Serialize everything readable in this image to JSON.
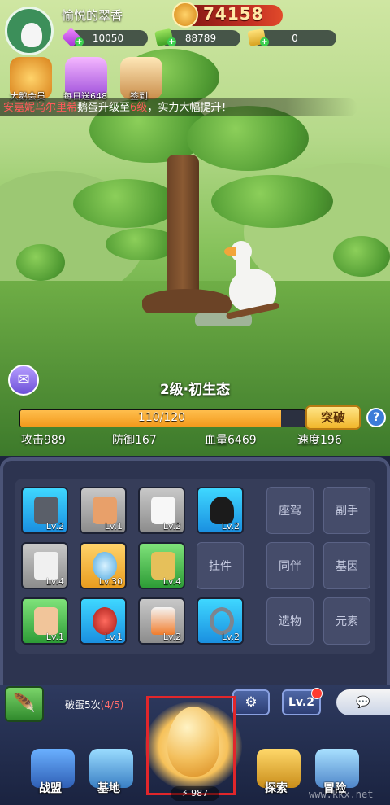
{
  "player": {
    "name": "愉悦的翠香",
    "power": "74158"
  },
  "currencies": [
    {
      "name": "gems",
      "value": "10050"
    },
    {
      "name": "cash",
      "value": "88789"
    },
    {
      "name": "tickets",
      "value": "0"
    }
  ],
  "top_menu": [
    {
      "label": "大鹅会员",
      "icon": "crown-icon"
    },
    {
      "label": "每日送648",
      "icon": "gift-icon"
    },
    {
      "label": "签到",
      "icon": "calendar-icon"
    }
  ],
  "news": {
    "name": "安嘉妮乌尔里希",
    "text_a": "鹅蛋升级至",
    "level": "6级",
    "text_b": "，实力大幅提升！"
  },
  "stage": {
    "title": "2级·初生态",
    "xp_text": "110/120",
    "xp_current": 110,
    "xp_max": 120,
    "break_label": "突破",
    "help_label": "?"
  },
  "stats": [
    {
      "label": "攻击989"
    },
    {
      "label": "防御167"
    },
    {
      "label": "血量6469"
    },
    {
      "label": "速度196"
    }
  ],
  "equipment": [
    {
      "name": "chainsaw",
      "level": "Lv.2",
      "rarity": "blue"
    },
    {
      "name": "muscle-arm",
      "level": "Lv.1",
      "rarity": "gray"
    },
    {
      "name": "tank-top",
      "level": "Lv.2",
      "rarity": "gray"
    },
    {
      "name": "balaclava",
      "level": "Lv.2",
      "rarity": "blue"
    },
    {
      "name": "paper-hat",
      "level": "Lv.4",
      "rarity": "gray"
    },
    {
      "name": "medal",
      "level": "Lv.30",
      "rarity": "gold"
    },
    {
      "name": "snack-bag",
      "level": "Lv.4",
      "rarity": "green"
    },
    {
      "name": "leg",
      "level": "Lv.1",
      "rarity": "green"
    },
    {
      "name": "bomb",
      "level": "Lv.1",
      "rarity": "blue"
    },
    {
      "name": "spray-can",
      "level": "Lv.2",
      "rarity": "gray"
    },
    {
      "name": "ring",
      "level": "Lv.2",
      "rarity": "blue"
    }
  ],
  "locked_slots": [
    "挂件",
    "座驾",
    "副手",
    "同伴",
    "基因",
    "遗物",
    "元素"
  ],
  "bottom": {
    "crack_label": "破蛋5次",
    "crack_count": "(4/5)",
    "level_button": "Lv.2",
    "egg_count": "987"
  },
  "nav": [
    {
      "label": "战盟",
      "icon": "alliance-icon"
    },
    {
      "label": "基地",
      "icon": "base-icon"
    },
    {
      "label": "探索",
      "icon": "explore-icon"
    },
    {
      "label": "冒险",
      "icon": "adventure-icon"
    }
  ],
  "watermark": "www.kkx.net",
  "colors": {
    "accent_orange": "#f29a1c",
    "break_button": "#f1b62a",
    "news_highlight": "#ff5a5a",
    "power_text": "#ffe9a8"
  }
}
